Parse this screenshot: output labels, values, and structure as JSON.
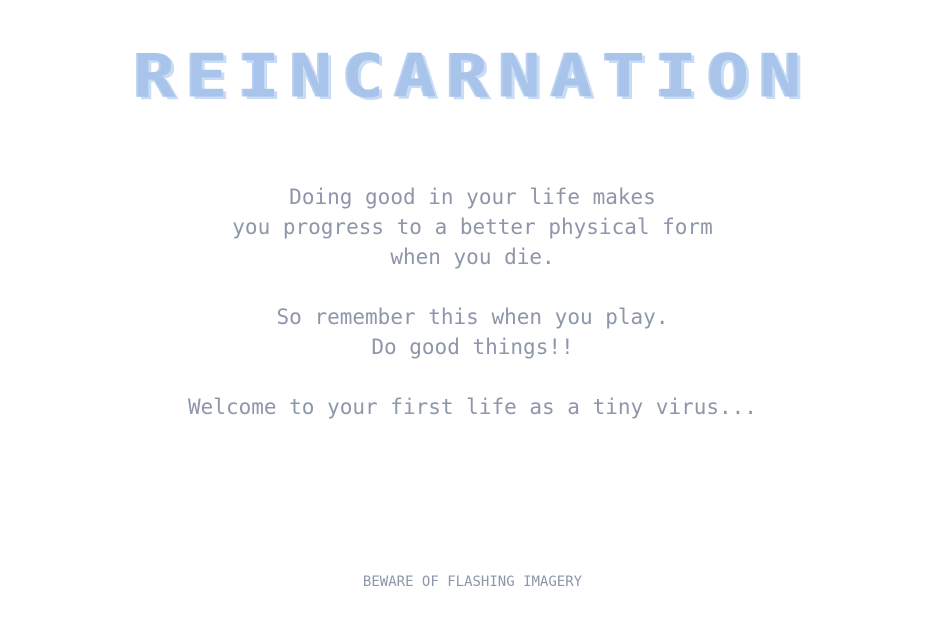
{
  "title": "REINCARNATION",
  "story": {
    "line1": "Doing good in your life makes",
    "line2": "you progress to a better physical form",
    "line3": "when you die.",
    "line4": "So remember this when you play.",
    "line5": "Do good things!!",
    "line6": "Welcome to your first life as a tiny virus..."
  },
  "warning": "BEWARE OF FLASHING IMAGERY",
  "colors": {
    "title": "#a9c4ea",
    "text": "#8e96aa",
    "background": "#ffffff"
  }
}
